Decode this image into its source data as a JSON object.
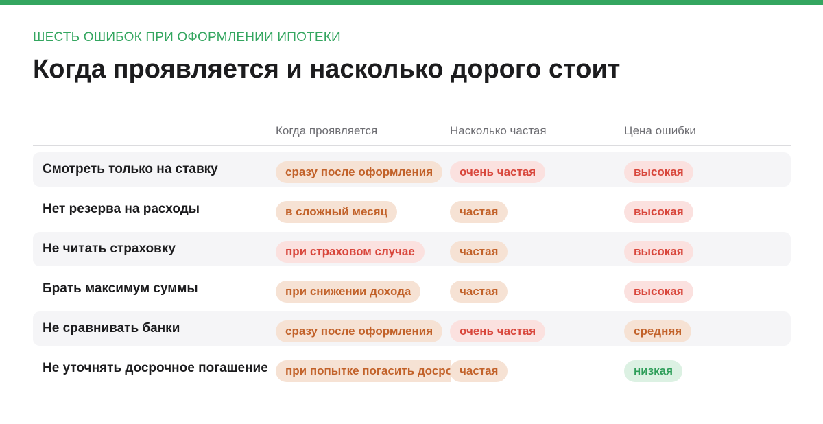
{
  "colors": {
    "accent": "#34a660",
    "orange_bg": "#f6e2d4",
    "orange_text": "#c2622a",
    "red_bg": "#fbe1df",
    "red_text": "#d8463b",
    "green_bg": "#dcf1e3",
    "green_text": "#2f9e5a"
  },
  "header": {
    "eyebrow": "ШЕСТЬ ОШИБОК ПРИ ОФОРМЛЕНИИ ИПОТЕКИ",
    "title": "Когда проявляется и насколько дорого стоит"
  },
  "table": {
    "columns": [
      "Когда проявляется",
      "Насколько частая",
      "Цена ошибки"
    ],
    "rows": [
      {
        "label": "Смотреть только на ставку",
        "when": {
          "text": "сразу после оформления",
          "tone": "orange"
        },
        "frequency": {
          "text": "очень частая",
          "tone": "red"
        },
        "cost": {
          "text": "высокая",
          "tone": "red"
        }
      },
      {
        "label": "Нет резерва на расходы",
        "when": {
          "text": "в сложный месяц",
          "tone": "orange"
        },
        "frequency": {
          "text": "частая",
          "tone": "orange"
        },
        "cost": {
          "text": "высокая",
          "tone": "red"
        }
      },
      {
        "label": "Не читать страховку",
        "when": {
          "text": "при страховом случае",
          "tone": "red"
        },
        "frequency": {
          "text": "частая",
          "tone": "orange"
        },
        "cost": {
          "text": "высокая",
          "tone": "red"
        }
      },
      {
        "label": "Брать максимум суммы",
        "when": {
          "text": "при снижении дохода",
          "tone": "orange"
        },
        "frequency": {
          "text": "частая",
          "tone": "orange"
        },
        "cost": {
          "text": "высокая",
          "tone": "red"
        }
      },
      {
        "label": "Не сравнивать банки",
        "when": {
          "text": "сразу после оформления",
          "tone": "orange"
        },
        "frequency": {
          "text": "очень частая",
          "tone": "red"
        },
        "cost": {
          "text": "средняя",
          "tone": "orange"
        }
      },
      {
        "label": "Не уточнять досрочное погашение",
        "when": {
          "text": "при попытке погасить досрочно",
          "tone": "orange"
        },
        "frequency": {
          "text": "частая",
          "tone": "orange"
        },
        "cost": {
          "text": "низкая",
          "tone": "green"
        }
      }
    ]
  }
}
